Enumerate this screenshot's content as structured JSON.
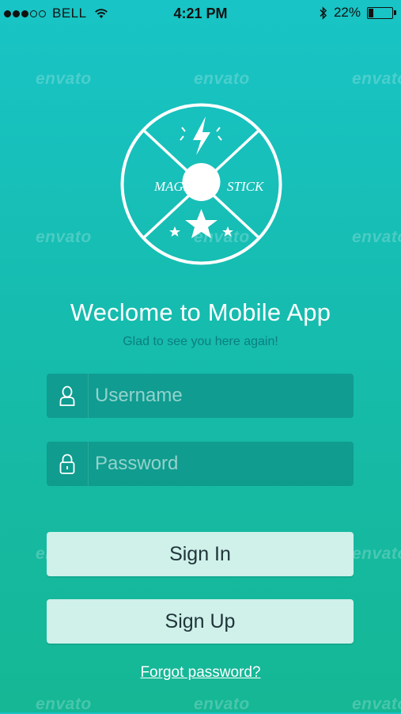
{
  "status_bar": {
    "carrier": "BELL",
    "time": "4:21 PM",
    "battery_percent_label": "22%",
    "battery_level": 0.22,
    "signal_bars_filled": 3,
    "signal_bars_total": 5
  },
  "logo": {
    "left_text": "MAGIC",
    "right_text": "STICK"
  },
  "welcome": {
    "title": "Weclome to Mobile App",
    "subtitle": "Glad to see you here again!"
  },
  "form": {
    "username_placeholder": "Username",
    "password_placeholder": "Password",
    "sign_in_label": "Sign In",
    "sign_up_label": "Sign Up",
    "forgot_label": "Forgot password?"
  },
  "watermark": {
    "text": "envato"
  },
  "colors": {
    "gradient_top": "#18c4c6",
    "gradient_bottom": "#15b794",
    "button_bg": "#d0f0ea",
    "subtitle": "#0b7f80"
  }
}
